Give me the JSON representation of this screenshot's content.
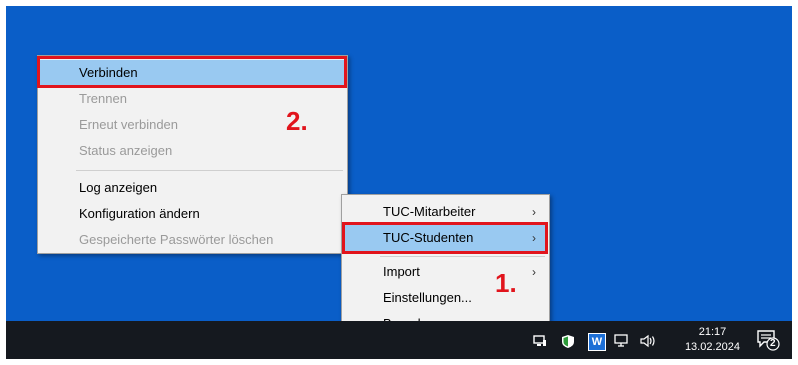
{
  "context_menu_left": {
    "items": [
      {
        "label": "Verbinden",
        "enabled": true,
        "highlighted": true
      },
      {
        "label": "Trennen",
        "enabled": false
      },
      {
        "label": "Erneut verbinden",
        "enabled": false
      },
      {
        "label": "Status anzeigen",
        "enabled": false
      },
      {
        "label": "Log anzeigen",
        "enabled": true
      },
      {
        "label": "Konfiguration ändern",
        "enabled": true
      },
      {
        "label": "Gespeicherte Passwörter löschen",
        "enabled": false
      }
    ]
  },
  "context_menu_right": {
    "items": [
      {
        "label": "TUC-Mitarbeiter",
        "submenu_arrow": "›"
      },
      {
        "label": "TUC-Studenten",
        "submenu_arrow": "›",
        "highlighted": true
      },
      {
        "label": "Import",
        "submenu_arrow": "›"
      },
      {
        "label": "Einstellungen..."
      },
      {
        "label": "Beenden"
      }
    ]
  },
  "annotations": {
    "step1": "1.",
    "step2": "2.",
    "color": "#e1141c"
  },
  "taskbar": {
    "time": "21:17",
    "date": "13.02.2024",
    "notification_count": "2",
    "tray_icons": [
      "network-computer-icon",
      "shield-icon",
      "word-w-icon",
      "monitor-icon",
      "speaker-icon"
    ]
  },
  "colors": {
    "desktop": "#0a5ec8",
    "taskbar": "#15191f",
    "menu_bg": "#f2f2f2",
    "highlight": "#99c9f1"
  }
}
